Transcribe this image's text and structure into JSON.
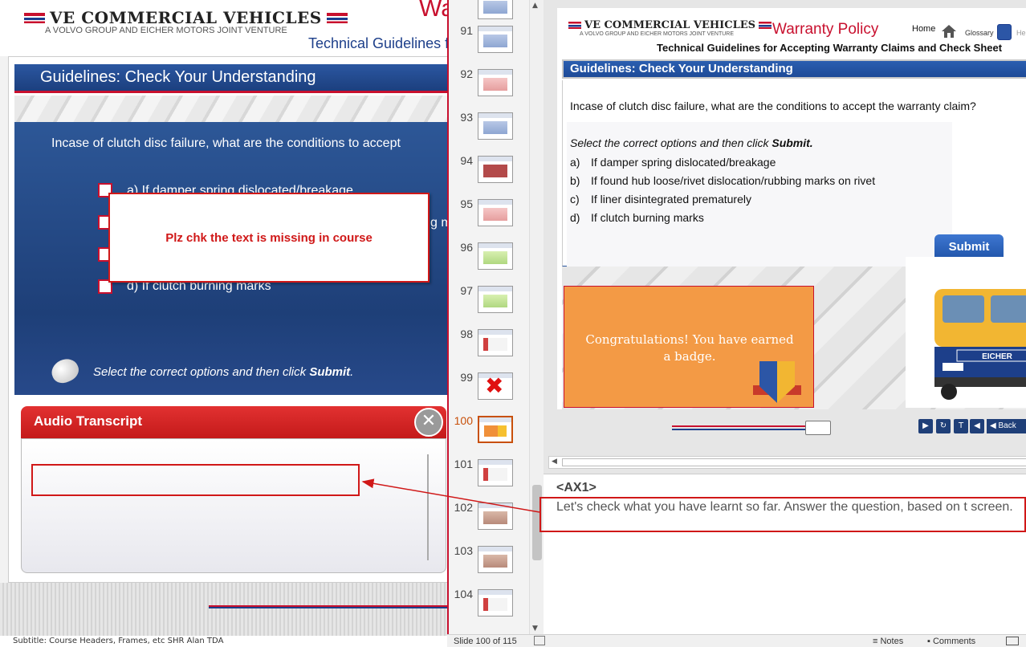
{
  "left_preview": {
    "brand": "VE COMMERCIAL VEHICLES",
    "joint_venture": "A VOLVO GROUP AND EICHER MOTORS JOINT VENTURE",
    "heading_fragment": "Wa",
    "subtitle_fragment": "Technical Guidelines for",
    "title": "Guidelines: Check Your Understanding",
    "question": "Incase of clutch disc failure, what are the conditions to accept",
    "options": [
      "a)   If damper spring dislocated/breakage",
      "b)",
      "c)",
      "d)   If clutch burning marks"
    ],
    "option_b_fragment": "g m",
    "instruction": "Select the correct options and then click ",
    "instruction_bold": "Submit",
    "instruction_end": ".",
    "review_note": "Plz chk the text is missing in course",
    "audio_transcript_title": "Audio Transcript",
    "close_glyph": "✕",
    "footer_text": "Subtitle: Course Headers, Frames, etc  SHR Alan TDA"
  },
  "thumbnails": [
    {
      "num": "",
      "style": "blue"
    },
    {
      "num": "91",
      "style": "blue"
    },
    {
      "num": "92",
      "style": "pink"
    },
    {
      "num": "93",
      "style": "blue"
    },
    {
      "num": "94",
      "style": "red"
    },
    {
      "num": "95",
      "style": "pink"
    },
    {
      "num": "96",
      "style": "green"
    },
    {
      "num": "97",
      "style": "green"
    },
    {
      "num": "98",
      "style": "person"
    },
    {
      "num": "99",
      "style": "x"
    },
    {
      "num": "100",
      "style": "orange",
      "selected": true
    },
    {
      "num": "101",
      "style": "person"
    },
    {
      "num": "102",
      "style": "photo"
    },
    {
      "num": "103",
      "style": "photo"
    },
    {
      "num": "104",
      "style": "person"
    }
  ],
  "slide": {
    "brand": "VE COMMERCIAL VEHICLES",
    "joint_venture": "A VOLVO GROUP AND EICHER MOTORS JOINT VENTURE",
    "course": "Warranty Policy",
    "home_label": "Home",
    "glossary_label": "Glossary",
    "help_fragment": "He",
    "subtitle": "Technical Guidelines for Accepting Warranty Claims and Check Sheet",
    "title": "Guidelines: Check Your Understanding",
    "question": "Incase  of clutch disc failure, what are the conditions to accept the  warranty claim?",
    "instruction": "Select the correct options and then click ",
    "instruction_bold": "Submit.",
    "options": [
      {
        "letter": "a)",
        "text": "If damper spring dislocated/breakage"
      },
      {
        "letter": "b)",
        "text": "If found hub loose/rivet dislocation/rubbing marks on rivet"
      },
      {
        "letter": "c)",
        "text": "If liner disintegrated prematurely"
      },
      {
        "letter": "d)",
        "text": "If clutch burning marks"
      }
    ],
    "submit_label": "Submit",
    "congrats": "Congratulations! You have earned a badge.",
    "truck_brand": "EICHER",
    "back_label": "Back"
  },
  "notes": {
    "tag": "<AX1>",
    "text": "Let's check what you have learnt so far. Answer the question, based on t screen."
  },
  "status_bar": {
    "slide_position": "Slide 100 of 115",
    "notes_label": "Notes",
    "comments_label": "Comments"
  },
  "colors": {
    "brand_red": "#c8102e",
    "brand_blue": "#1d3f8a",
    "annotation_red": "#d01818",
    "badge_orange": "#f39a45"
  }
}
